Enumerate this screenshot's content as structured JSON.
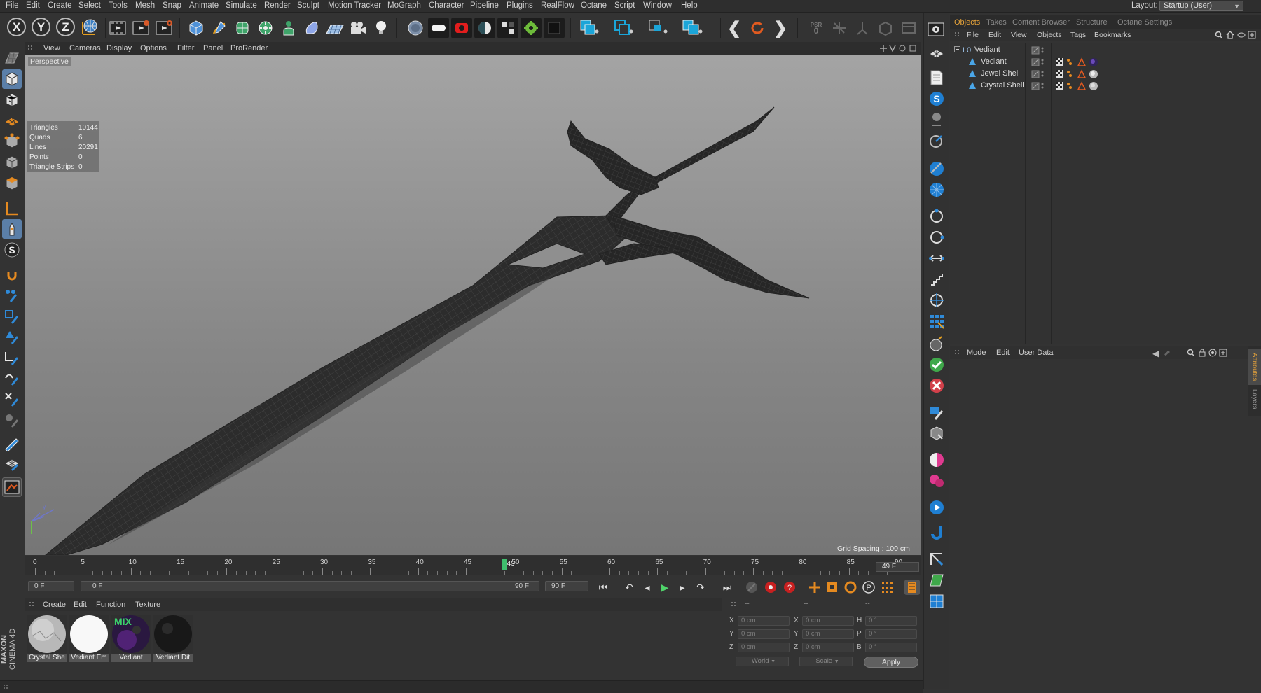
{
  "menubar": {
    "items": [
      "File",
      "Edit",
      "Create",
      "Select",
      "Tools",
      "Mesh",
      "Snap",
      "Animate",
      "Simulate",
      "Render",
      "Sculpt",
      "Motion Tracker",
      "MoGraph",
      "Character",
      "Pipeline",
      "Plugins",
      "RealFlow",
      "Octane",
      "Script",
      "Window",
      "Help"
    ],
    "layout_label": "Layout:",
    "layout_value": "Startup (User)"
  },
  "toolbar": {
    "axis_x": "X",
    "axis_y": "Y",
    "axis_z": "Z",
    "psr_label": "PSR",
    "psr_value": "0"
  },
  "viewport": {
    "menu": [
      "View",
      "Cameras",
      "Display",
      "Options",
      "Filter",
      "Panel",
      "ProRender"
    ],
    "label": "Perspective",
    "stats": [
      {
        "label": "Triangles",
        "value": "10144"
      },
      {
        "label": "Quads",
        "value": "6"
      },
      {
        "label": "Lines",
        "value": "20291"
      },
      {
        "label": "Points",
        "value": "0"
      },
      {
        "label": "Triangle Strips",
        "value": "0"
      }
    ],
    "grid_spacing": "Grid Spacing : 100 cm"
  },
  "timeline": {
    "ticks": [
      "0",
      "5",
      "10",
      "15",
      "20",
      "25",
      "30",
      "35",
      "40",
      "45",
      "50",
      "55",
      "60",
      "65",
      "70",
      "75",
      "80",
      "85",
      "90"
    ],
    "current_frame": 49,
    "playhead_label": "49",
    "end_field": "49 F"
  },
  "transport": {
    "start_field": "0 F",
    "range_start": "0 F",
    "range_end": "90 F",
    "end_field": "90 F"
  },
  "materials": {
    "menu": [
      "Create",
      "Edit",
      "Function",
      "Texture"
    ],
    "items": [
      {
        "name": "Crystal She"
      },
      {
        "name": "Vediant Em"
      },
      {
        "name": "Vediant",
        "overlay": "MIX"
      },
      {
        "name": "Vediant Dit"
      }
    ],
    "brand_top": "MAXON",
    "brand_bottom": "CINEMA 4D"
  },
  "coordinates": {
    "header_a": "--",
    "header_b": "--",
    "header_c": "--",
    "rows": [
      {
        "a_label": "X",
        "a_value": "0 cm",
        "b_label": "X",
        "b_value": "0 cm",
        "c_label": "H",
        "c_value": "0 °"
      },
      {
        "a_label": "Y",
        "a_value": "0 cm",
        "b_label": "Y",
        "b_value": "0 cm",
        "c_label": "P",
        "c_value": "0 °"
      },
      {
        "a_label": "Z",
        "a_value": "0 cm",
        "b_label": "Z",
        "b_value": "0 cm",
        "c_label": "B",
        "c_value": "0 °"
      }
    ],
    "mode_select": "World",
    "scale_select": "Scale",
    "apply_label": "Apply"
  },
  "object_manager": {
    "tabs": [
      "Objects",
      "Takes",
      "Content Browser",
      "Structure",
      "Octane Settings"
    ],
    "active_tab": "Objects",
    "menu": [
      "File",
      "Edit",
      "View",
      "Objects",
      "Tags",
      "Bookmarks"
    ],
    "objects": [
      {
        "name": "Vediant",
        "type": "null"
      },
      {
        "name": "Vediant",
        "type": "mesh"
      },
      {
        "name": "Jewel Shell",
        "type": "mesh"
      },
      {
        "name": "Crystal Shell",
        "type": "mesh"
      }
    ]
  },
  "attribute_manager": {
    "menu": [
      "Mode",
      "Edit",
      "User Data"
    ],
    "side_tabs": [
      "Attributes",
      "Layers"
    ]
  },
  "colors": {
    "accent_orange": "#e6a33a",
    "active_blue": "#5b7fa8",
    "playhead_green": "#3fbf6e"
  }
}
